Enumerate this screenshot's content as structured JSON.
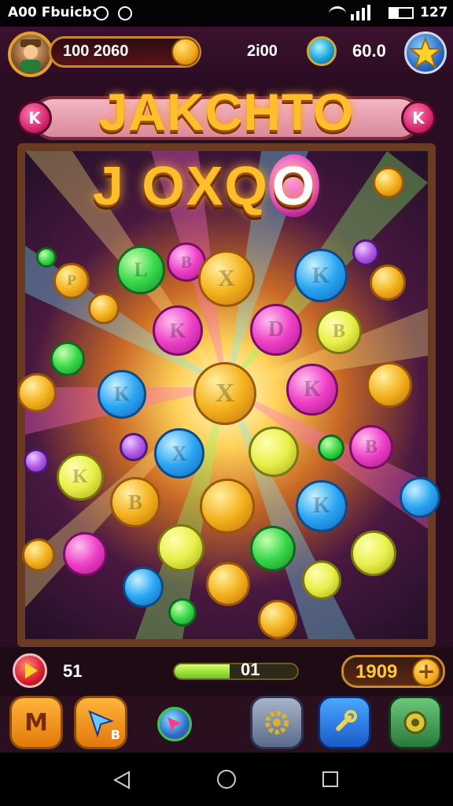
{
  "status_bar": {
    "left_text": "A00 Fbuicb:",
    "time": "127"
  },
  "top_bar": {
    "coins": "100 2060",
    "gems": "2i00",
    "score": "60.0"
  },
  "title": "JAKCHTO",
  "gem_left_label": "K",
  "gem_right_label": "K",
  "subtitle": "J OXQ",
  "subtitle_highlight": "O",
  "coin_letters": [
    "L",
    "B",
    "X",
    "K",
    "P",
    "K",
    "D",
    "B",
    "K",
    "X",
    "K",
    "B",
    "X",
    "K",
    "B",
    "K"
  ],
  "bottom_bar": {
    "level": "51",
    "progress_label": "01",
    "progress": 0.45,
    "bank": "1909"
  },
  "footer_buttons": [
    {
      "name": "menu-button",
      "icon": "m-icon",
      "label": "M"
    },
    {
      "name": "arrow-button",
      "icon": "arrow-icon",
      "label": "B"
    },
    {
      "name": "spin-button",
      "icon": "spin-icon"
    },
    {
      "name": "settings-button",
      "icon": "gear-icon"
    },
    {
      "name": "tool-button",
      "icon": "wrench-icon"
    },
    {
      "name": "badge-button",
      "icon": "badge-icon"
    }
  ],
  "colors": {
    "gold": "#f2a91c",
    "plank": "#f4b6c3",
    "board_frame": "#6a3a22"
  }
}
